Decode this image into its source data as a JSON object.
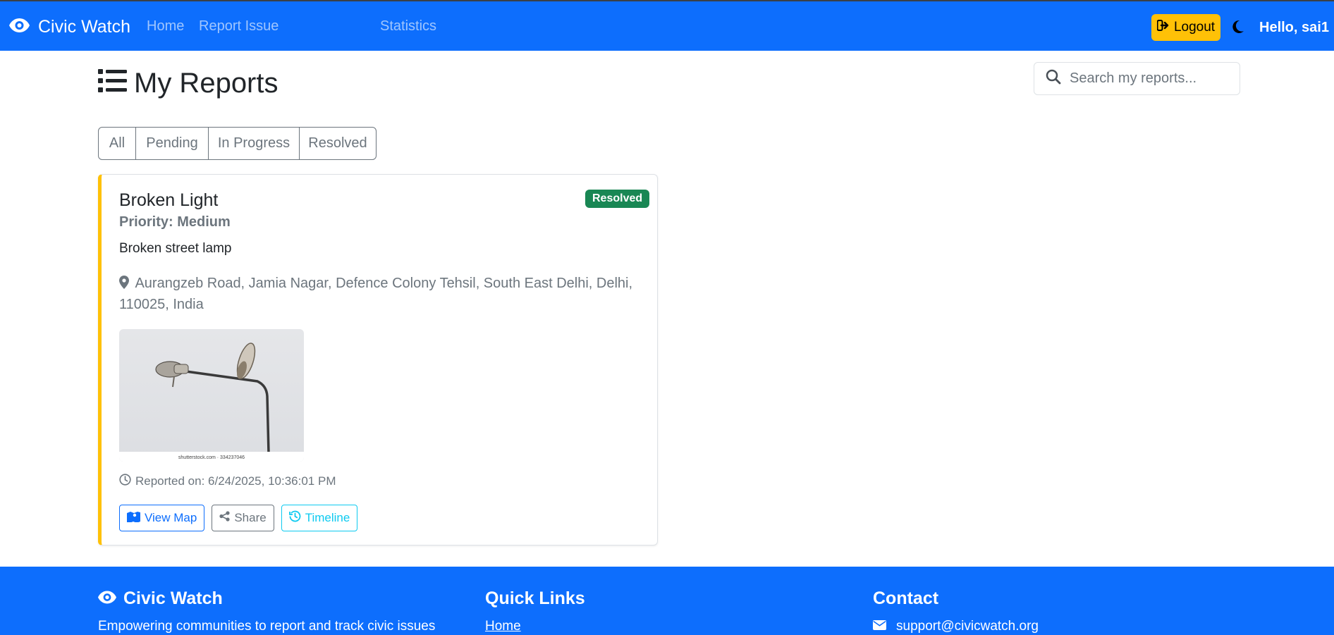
{
  "navbar": {
    "brand": "Civic Watch",
    "links": [
      "Home",
      "Report Issue",
      "Statistics"
    ],
    "logout_label": "Logout",
    "greeting": "Hello, sai1"
  },
  "page": {
    "title": "My Reports",
    "search_placeholder": "Search my reports..."
  },
  "filters": [
    "All",
    "Pending",
    "In Progress",
    "Resolved"
  ],
  "report": {
    "title": "Broken Light",
    "status": "Resolved",
    "status_color": "#198754",
    "accent_color": "#ffc107",
    "priority": "Priority: Medium",
    "description": "Broken street lamp",
    "address": "Aurangzeb Road, Jamia Nagar, Defence Colony Tehsil, South East Delhi, Delhi, 110025, India",
    "image_watermark": "shutterstock.com · 334237046",
    "reported_on": "Reported on: 6/24/2025, 10:36:01 PM",
    "actions": {
      "view_map": "View Map",
      "share": "Share",
      "timeline": "Timeline"
    }
  },
  "footer": {
    "brand": "Civic Watch",
    "tagline": "Empowering communities to report and track civic issues",
    "quick_links_heading": "Quick Links",
    "quick_links": [
      "Home"
    ],
    "contact_heading": "Contact",
    "email": "support@civicwatch.org"
  },
  "colors": {
    "primary": "#0d6efd",
    "warning": "#ffc107",
    "success": "#198754",
    "info": "#0dcaf0"
  }
}
